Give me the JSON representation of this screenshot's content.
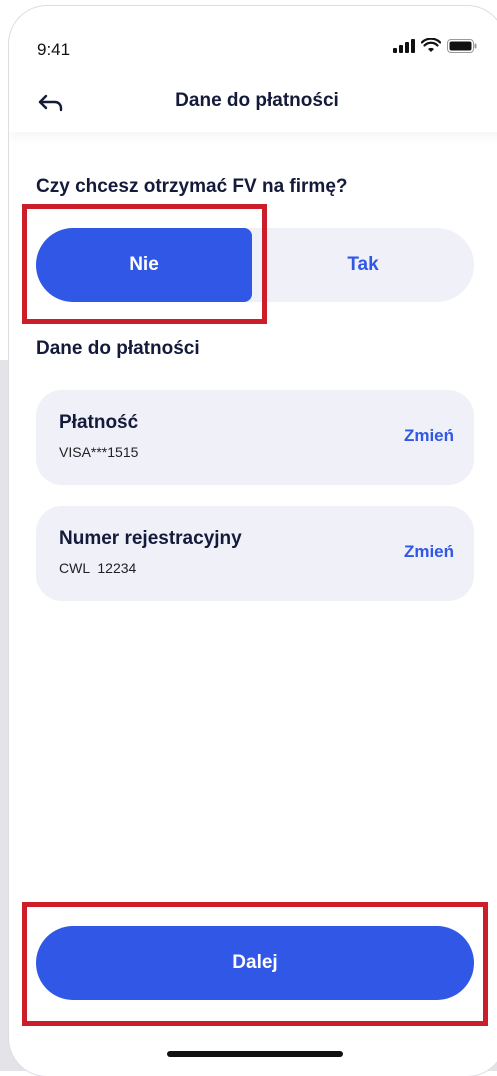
{
  "status_bar": {
    "time": "9:41"
  },
  "header": {
    "title": "Dane do płatności"
  },
  "invoice": {
    "question": "Czy chcesz otrzymać FV na firmę?",
    "options": [
      {
        "label": "Nie",
        "selected": true
      },
      {
        "label": "Tak",
        "selected": false
      }
    ]
  },
  "payment_section": {
    "title": "Dane do płatności",
    "cards": [
      {
        "label": "Płatność",
        "value": "VISA***1515",
        "action": "Zmień"
      },
      {
        "label": "Numer rejestracyjny",
        "value": "CWL  12234",
        "action": "Zmień"
      }
    ]
  },
  "footer": {
    "next_label": "Dalej"
  },
  "colors": {
    "accent": "#3057e6",
    "card_bg": "#eff0f8",
    "text_dark": "#141a3a",
    "highlight": "#cc1e2a"
  },
  "icons": [
    "back-arrow-icon",
    "signal-icon",
    "wifi-icon",
    "battery-icon"
  ]
}
